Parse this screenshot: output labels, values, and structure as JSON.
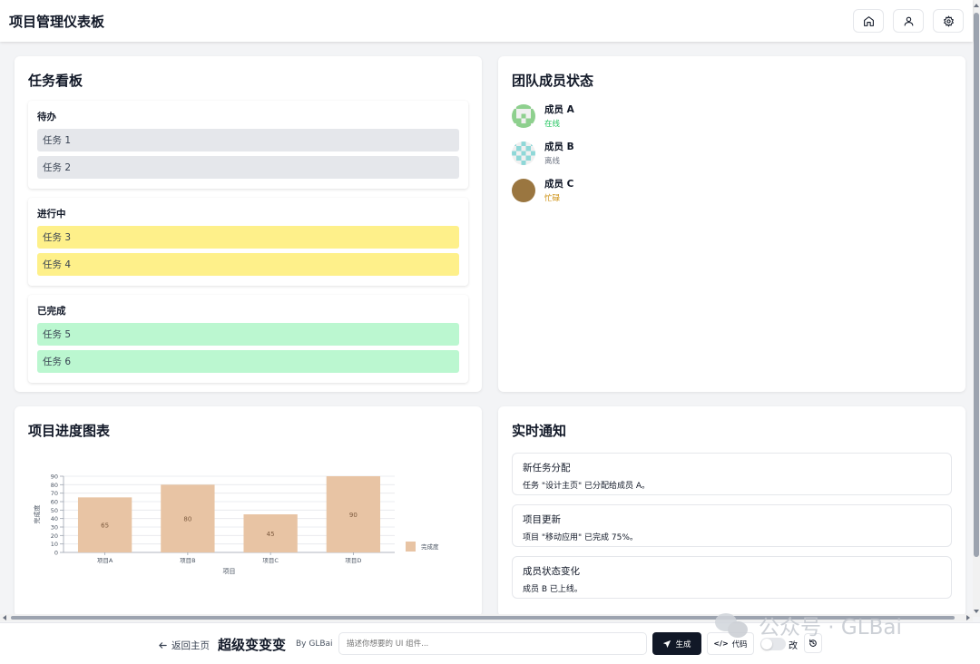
{
  "header": {
    "title": "项目管理仪表板",
    "icons": [
      "home-icon",
      "user-icon",
      "settings-icon"
    ]
  },
  "board": {
    "title": "任务看板",
    "columns": [
      {
        "name": "待办",
        "tasks": [
          "任务 1",
          "任务 2"
        ]
      },
      {
        "name": "进行中",
        "tasks": [
          "任务 3",
          "任务 4"
        ]
      },
      {
        "name": "已完成",
        "tasks": [
          "任务 5",
          "任务 6"
        ]
      }
    ]
  },
  "team": {
    "title": "团队成员状态",
    "members": [
      {
        "name": "成员 A",
        "status": "在线",
        "color": "#22c55e"
      },
      {
        "name": "成员 B",
        "status": "离线",
        "color": "#6b7280"
      },
      {
        "name": "成员 C",
        "status": "忙碌",
        "color": "#ca8a04"
      }
    ]
  },
  "progress": {
    "title": "项目进度图表",
    "chart_data": {
      "type": "bar",
      "categories": [
        "项目A",
        "项目B",
        "项目C",
        "项目D"
      ],
      "series": [
        {
          "name": "完成度",
          "values": [
            65,
            80,
            45,
            90
          ],
          "color": "#e8c4a4"
        }
      ],
      "xlabel": "项目",
      "ylabel": "完成度",
      "ylim": [
        0,
        90
      ],
      "yticks": [
        0,
        10,
        20,
        30,
        40,
        50,
        60,
        70,
        80,
        90
      ],
      "grid": true,
      "legend": "right"
    }
  },
  "notifications": {
    "title": "实时通知",
    "items": [
      {
        "title": "新任务分配",
        "body": "任务 \"设计主页\" 已分配给成员 A。"
      },
      {
        "title": "项目更新",
        "body": "项目 \"移动应用\" 已完成 75%。"
      },
      {
        "title": "成员状态变化",
        "body": "成员 B 已上线。"
      }
    ]
  },
  "bottombar": {
    "back_label": "返回主页",
    "brand": "超级变变变",
    "by": "By GLBai",
    "prompt_placeholder": "描述你想要的 UI 组件...",
    "generate_label": "生成",
    "code_label": "代码",
    "toggle_label": "改"
  },
  "watermark": "公众号 · GLBai"
}
